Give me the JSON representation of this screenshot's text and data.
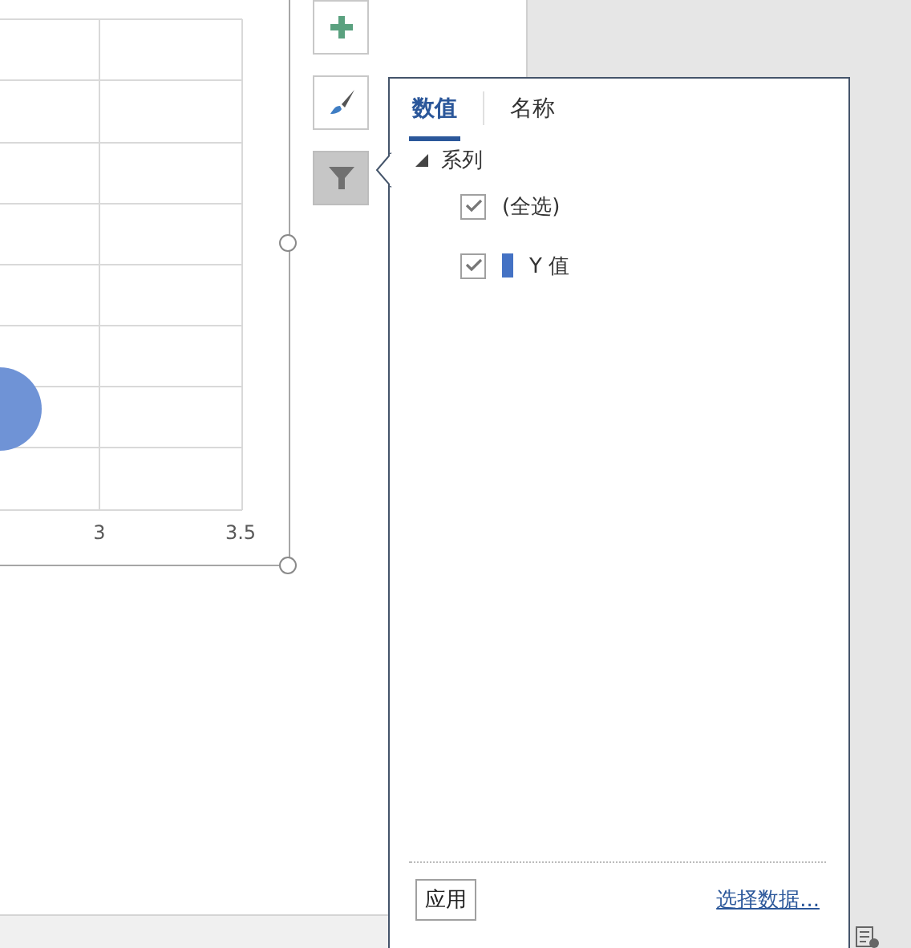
{
  "chart": {
    "x_tick_labels": [
      "3",
      "3.5"
    ]
  },
  "chart_buttons": [
    {
      "kind": "add",
      "selected": false
    },
    {
      "kind": "style",
      "selected": false
    },
    {
      "kind": "filter",
      "selected": true
    }
  ],
  "filter_panel": {
    "tabs": [
      {
        "label": "数值",
        "selected": true
      },
      {
        "label": "名称",
        "selected": false
      }
    ],
    "tree": [
      {
        "label": "系列",
        "expanded": true,
        "children": [
          {
            "label": "(全选)",
            "checked": true
          },
          {
            "label": "Y 值",
            "checked": true,
            "color": "#4472c4"
          }
        ]
      }
    ],
    "apply_button": "应用",
    "select_data_link": "选择数据..."
  }
}
